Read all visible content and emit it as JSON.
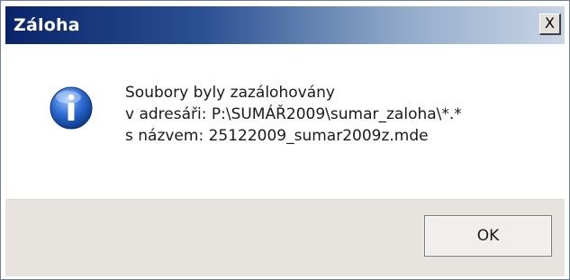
{
  "window": {
    "title": "Záloha",
    "close_label": "X"
  },
  "message": {
    "icon": "info-icon",
    "lines": [
      "Soubory byly zazálohovány",
      "v adresáři: P:\\SUMÁŘ2009\\sumar_zaloha\\*.*",
      "s názvem: 25122009_sumar2009z.mde"
    ]
  },
  "buttons": {
    "ok_label": "OK"
  },
  "colors": {
    "titlebar_start": "#0a246a",
    "titlebar_end": "#c9d6e6",
    "footer_bg": "#e7e3de",
    "icon_blue": "#2d6ad0"
  }
}
